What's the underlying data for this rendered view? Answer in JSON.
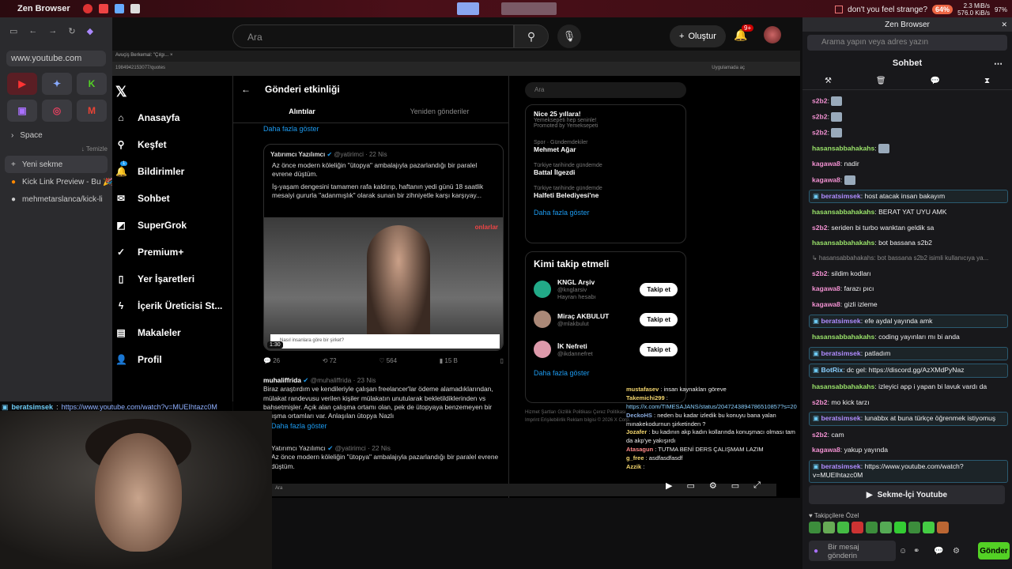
{
  "sysbar": {
    "app": "Zen Browser",
    "status": "don't you feel strange?",
    "cpu": "64%",
    "net_up": "2.3 MiB/s",
    "net_down": "576.0 KiB/s",
    "battery": "97%"
  },
  "sidebar": {
    "url": "www.youtube.com",
    "space": "Space",
    "clear": "↓ Temizle",
    "new_tab": "Yeni sekme",
    "tabs": [
      "Kick Link Preview - Bu 🎉",
      "mehmetarslanca/kick-li"
    ]
  },
  "youtube": {
    "search_placeholder": "Ara",
    "create": "Oluştur",
    "notif": "9+"
  },
  "video": {
    "inner_tab": "Avuçiş Berkemal: \"Çılgı... ×",
    "inner_url": "1984942153077/quotes",
    "inner_app": "Uygulamada aç",
    "x_nav": [
      "Anasayfa",
      "Keşfet",
      "Bildirimler",
      "Sohbet",
      "SuperGrok",
      "Premium+",
      "Yer İşaretleri",
      "İçerik Üreticisi St...",
      "Makaleler",
      "Profil"
    ],
    "x_nav_badge": "1",
    "post_header": "Gönderi etkinliği",
    "tabs": [
      "Alıntılar",
      "Yeniden gönderiler"
    ],
    "show_more": "Daha fazla göster",
    "quote_author": "Yatırımcı Yazılımcı",
    "quote_handle": "@yatirimci · 22 Nis",
    "quote_text1": "Az önce modern köleliğin \"ütopya\" ambalajıyla pazarlandığı bir paralel evrene düştüm.",
    "quote_text2": "İş-yaşam dengesini tamamen rafa kaldırıp, haftanın yedi günü 18 saatlik mesaiyi gururla \"adanmışlık\" olarak sunan bir zihniyetle karşı karşıyay...",
    "video_brand": "onlarlar",
    "video_caption": "Nasıl insanlara göre bir şirket?",
    "video_time": "1:30",
    "stats": [
      "26",
      "72",
      "564",
      "15 B"
    ],
    "reply_author": "muhaliffrida",
    "reply_handle": "@muhaliffrida · 23 Nis",
    "reply_text": "Biraz araştırdım ve kendileriyle çalışan freelancer'lar ödeme alamadıklarından, mülakat randevusu verilen kişiler mülakatın unutularak bekletildiklerinden vs bahsetmişler. Açık alan çalışma ortamı olan, pek de ütopyaya benzemeyen bir çalışma ortamları var. Anlaşılan ütopya Nazlı",
    "reply_more": "Daha fazla göster",
    "reply2_author": "Yatırımcı Yazılımcı",
    "reply2_handle": "@yatirimci · 22 Nis",
    "reply2_text": "Az önce modern köleliğin \"ütopya\" ambalajıyla pazarlandığı bir paralel evrene düştüm.",
    "right_search": "Ara",
    "trends": [
      {
        "title": "Nice 25 yıllara!",
        "sub": "Yemeksepeti hep seninle!"
      },
      {
        "title": "",
        "sub": "Promoted by Yemeksepeti"
      },
      {
        "sub": "Spor · Gündemdekiler",
        "title": "Mehmet Ağar"
      },
      {
        "sub": "Türkiye tarihinde gündemde",
        "title": "Battal İlgezdi"
      },
      {
        "sub": "Türkiye tarihinde gündemde",
        "title": "Halfeti Belediyesi'ne"
      }
    ],
    "trends_more": "Daha fazla göster",
    "follow_title": "Kimi takip etmeli",
    "follow": [
      {
        "name": "KNGL Arşiv",
        "handle": "@knglarsiv",
        "extra": "Hayran hesabı"
      },
      {
        "name": "Miraç AKBULUT",
        "handle": "@mlakbulut",
        "extra": ""
      },
      {
        "name": "İK Nefreti",
        "handle": "@ikdannefret",
        "extra": ""
      }
    ],
    "follow_btn": "Takip et",
    "follow_more": "Daha fazla göster",
    "footer": "Hizmet Şartları  Gizlilik Politikası  Çerez Politikası  Imprint  Erişilebilirlik  Reklam bilgisi  © 2026 X Corp.",
    "overlay_chat": [
      {
        "u": "mustafasev",
        "t": "insan kaynakları göreve"
      },
      {
        "u": "Takemichi299",
        "t": ""
      },
      {
        "u": "",
        "t": "https://x.com/TIMESAJANS/status/2047243894786510857?s=20"
      },
      {
        "u": "DeckoHS",
        "t": "neden bu kadar izledik bu konuyu bana yalan mınakekodurnun şirketinden ?"
      },
      {
        "u": "Jozafer",
        "t": "bu kadının akp kadın kollarında konuşmacı olması tam da akp'ye yakışırdı"
      },
      {
        "u": "Atasagun",
        "t": "TUTMA BENİ DERS ÇALIŞMAM LAZIM"
      },
      {
        "u": "g_free",
        "t": "asdfasdfasdf"
      },
      {
        "u": "Azzik",
        "t": ""
      }
    ],
    "taskbar": "Ara"
  },
  "desktop_chat": {
    "user": "beratsimsek",
    "link": "https://www.youtube.com/watch?v=MUEIhtazc0M"
  },
  "zen": {
    "title": "Zen Browser",
    "url_placeholder": "Arama yapın veya adres yazın",
    "chat_title": "Sohbet",
    "messages": [
      {
        "u": "s2b2",
        "c": "c-pink",
        "t": "",
        "hl": false
      },
      {
        "u": "s2b2",
        "c": "c-pink",
        "t": "",
        "hl": false
      },
      {
        "u": "s2b2",
        "c": "c-pink",
        "t": "",
        "hl": false
      },
      {
        "u": "hasansabbahakahs",
        "c": "c-green",
        "t": "",
        "hl": false
      },
      {
        "u": "kagawa8",
        "c": "c-pink",
        "t": "nadir",
        "hl": false
      },
      {
        "u": "kagawa8",
        "c": "c-pink",
        "t": "",
        "hl": false
      },
      {
        "u": "beratsimsek",
        "c": "c-purple",
        "t": "host atacak insan bakayım",
        "hl": true
      },
      {
        "u": "hasansabbahakahs",
        "c": "c-green",
        "t": "BERAT YAT UYU AMK",
        "hl": false
      },
      {
        "u": "s2b2",
        "c": "c-pink",
        "t": "seriden bi turbo wanktan geldik sa",
        "hl": false
      },
      {
        "u": "hasansabbahakahs",
        "c": "c-green",
        "t": "bot bassana s2b2",
        "hl": false
      },
      {
        "u": "",
        "c": "",
        "t": "↳ hasansabbahakahs: bot bassana s2b2 isimli kullanıcıya ya...",
        "hl": false,
        "sys": true
      },
      {
        "u": "s2b2",
        "c": "c-pink",
        "t": "sildim kodları",
        "hl": false
      },
      {
        "u": "kagawa8",
        "c": "c-pink",
        "t": "farazı pıcı",
        "hl": false
      },
      {
        "u": "kagawa8",
        "c": "c-pink",
        "t": "gizli izleme",
        "hl": false
      },
      {
        "u": "beratsimsek",
        "c": "c-purple",
        "t": "efe aydal yayında amk",
        "hl": true
      },
      {
        "u": "hasansabbahakahs",
        "c": "c-green",
        "t": "coding yayınları mı bi anda",
        "hl": false
      },
      {
        "u": "beratsimsek",
        "c": "c-purple",
        "t": "patladım",
        "hl": true
      },
      {
        "u": "BotRix",
        "c": "c-lblue",
        "t": "dc gel: https://discord.gg/AzXMdPyNaz",
        "hl": true
      },
      {
        "u": "hasansabbahakahs",
        "c": "c-green",
        "t": "izleyici app i yapan bi lavuk vardı da",
        "hl": false
      },
      {
        "u": "s2b2",
        "c": "c-pink",
        "t": "mo kick tarzı",
        "hl": false
      },
      {
        "u": "beratsimsek",
        "c": "c-purple",
        "t": "lunabbx at buna türkçe öğrenmek istiyomuş",
        "hl": true
      },
      {
        "u": "s2b2",
        "c": "c-pink",
        "t": "cam",
        "hl": false
      },
      {
        "u": "kagawa8",
        "c": "c-pink",
        "t": "yakup yayında",
        "hl": false
      },
      {
        "u": "beratsimsek",
        "c": "c-purple",
        "t": "https://www.youtube.com/watch?v=MUEIhtazc0M",
        "hl": true
      }
    ],
    "sekme_btn": "Sekme-İçi Youtube",
    "emote_header": "Takipçilere Özel",
    "input_placeholder": "Bir mesaj gönderin",
    "send": "Gönder"
  }
}
